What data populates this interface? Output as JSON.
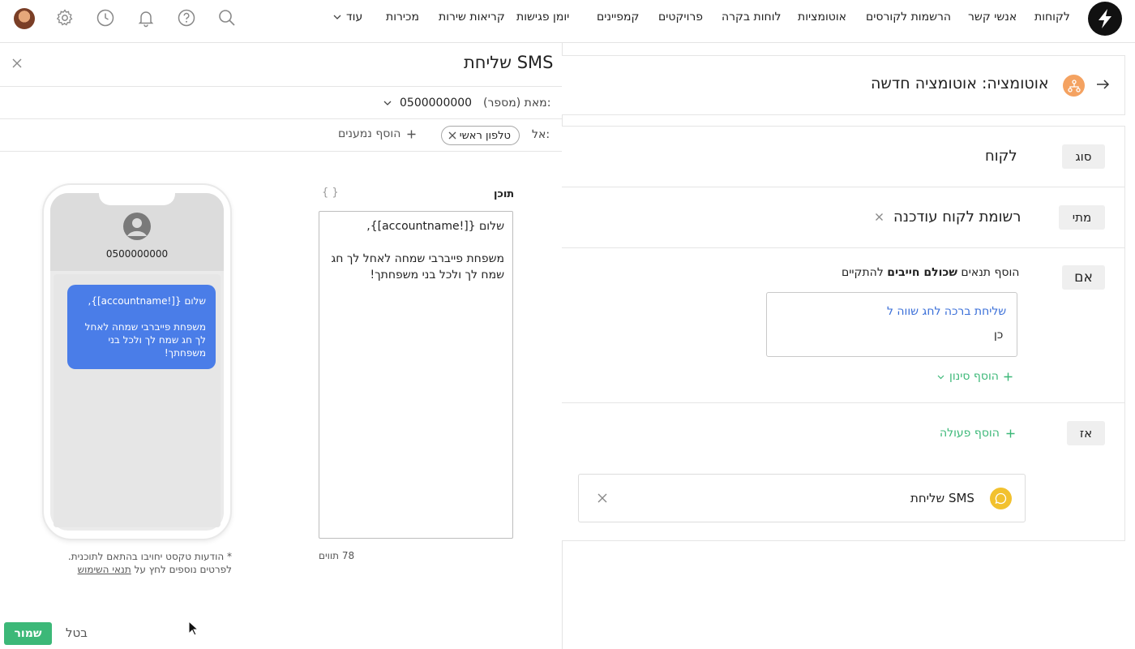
{
  "nav": {
    "items": [
      "לקוחות",
      "אנשי קשר",
      "הרשמות לקורסים",
      "אוטומציות",
      "לוחות בקרה",
      "פרויקטים",
      "קמפיינים",
      "יומן פגישות",
      "קריאות שירות",
      "מכירות"
    ],
    "more": "עוד"
  },
  "automation": {
    "title": "אוטומציה: אוטומציה חדשה",
    "type_label": "סוג",
    "type_value": "לקוח",
    "when_label": "מתי",
    "when_value": "רשומת לקוח עודכנה",
    "if_label": "אם",
    "if_hint_prefix": "הוסף תנאים ",
    "if_hint_bold": "שכולם חייבים",
    "if_hint_suffix": " להתקיים",
    "condition_field": "שליחת ברכה לחג שווה ל",
    "condition_value": "כן",
    "add_filter": "הוסף סינון",
    "then_label": "אז",
    "add_action": "הוסף פעולה",
    "action_name": "שליחת SMS"
  },
  "sms": {
    "title": "שליחת SMS",
    "from_label": "מאת (מספר):",
    "from_value": "0500000000",
    "to_label": "אל:",
    "recipient_chip": "טלפון ראשי",
    "add_recipients": "הוסף נמענים",
    "content_label": "תוכן",
    "variables_icon": "{ }",
    "content_line1": "שלום  {[!accountname]},",
    "content_line2": "משפחת פייברבי שמחה לאחל לך חג שמח לך ולכל בני משפחתך!",
    "char_count": "78 תווים",
    "phone_number": "0500000000",
    "bubble_line1": "שלום  {[!accountname]},",
    "bubble_line2": "משפחת פייברבי שמחה לאחל לך חג שמח לך ולכל בני משפחתך!",
    "note_line1": "* הודעות טקסט יחויבו בהתאם לתוכנית.",
    "note_line2_prefix": "לפרטים נוספים לחץ על ",
    "note_link": "תנאי השימוש",
    "save": "שמור",
    "cancel": "בטל"
  },
  "colors": {
    "accent_green": "#3cb878",
    "bubble_blue": "#4a7de8",
    "automation_icon": "#f4a261",
    "sms_icon": "#f2c12e",
    "link_blue": "#3a6fd8"
  }
}
